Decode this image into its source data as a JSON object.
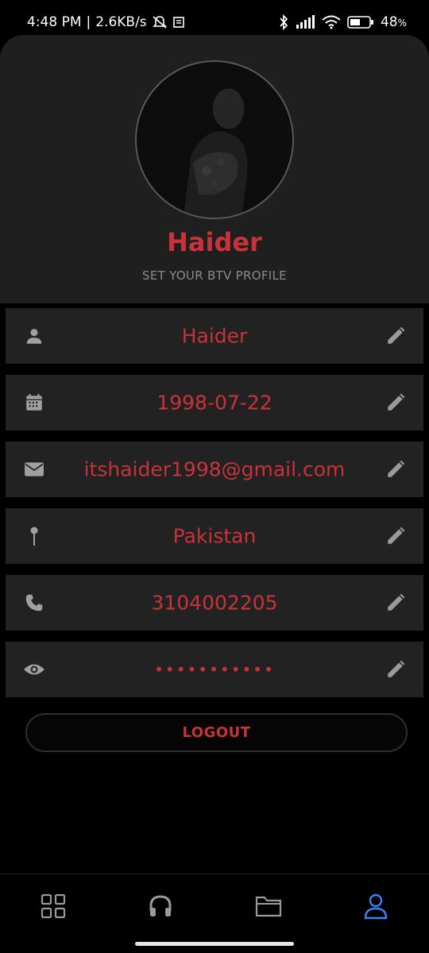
{
  "status_bar": {
    "time": "4:48 PM",
    "network_speed": "2.6KB/s",
    "battery_percent": "48",
    "battery_suffix": "%",
    "left_icons": [
      "mute-icon",
      "notification-icon"
    ],
    "right_icons": [
      "bluetooth-icon",
      "signal-icon",
      "wifi-icon",
      "battery-icon"
    ]
  },
  "profile": {
    "name": "Haider",
    "subtitle": "SET YOUR BTV PROFILE",
    "avatar": "profile-photo"
  },
  "fields": [
    {
      "icon": "person-icon",
      "value": "Haider"
    },
    {
      "icon": "calendar-icon",
      "value": "1998-07-22"
    },
    {
      "icon": "mail-icon",
      "value": "itshaider1998@gmail.com"
    },
    {
      "icon": "pin-icon",
      "value": "Pakistan"
    },
    {
      "icon": "phone-icon",
      "value": "3104002205"
    },
    {
      "icon": "eye-icon",
      "value": "•••••••••••"
    }
  ],
  "edit_icon": "pencil-icon",
  "logout": {
    "label": "LOGOUT"
  },
  "bottom_nav": {
    "items": [
      {
        "icon": "grid-icon",
        "active": false
      },
      {
        "icon": "headphones-icon",
        "active": false
      },
      {
        "icon": "folder-icon",
        "active": false
      },
      {
        "icon": "profile-icon",
        "active": true
      }
    ],
    "active_color": "#3b82f6",
    "inactive_color": "#9a9a9a"
  },
  "colors": {
    "accent": "#c8333a",
    "card_background": "#222222",
    "header_background": "#1f1f1f",
    "icon_gray": "#a0a0a0"
  }
}
